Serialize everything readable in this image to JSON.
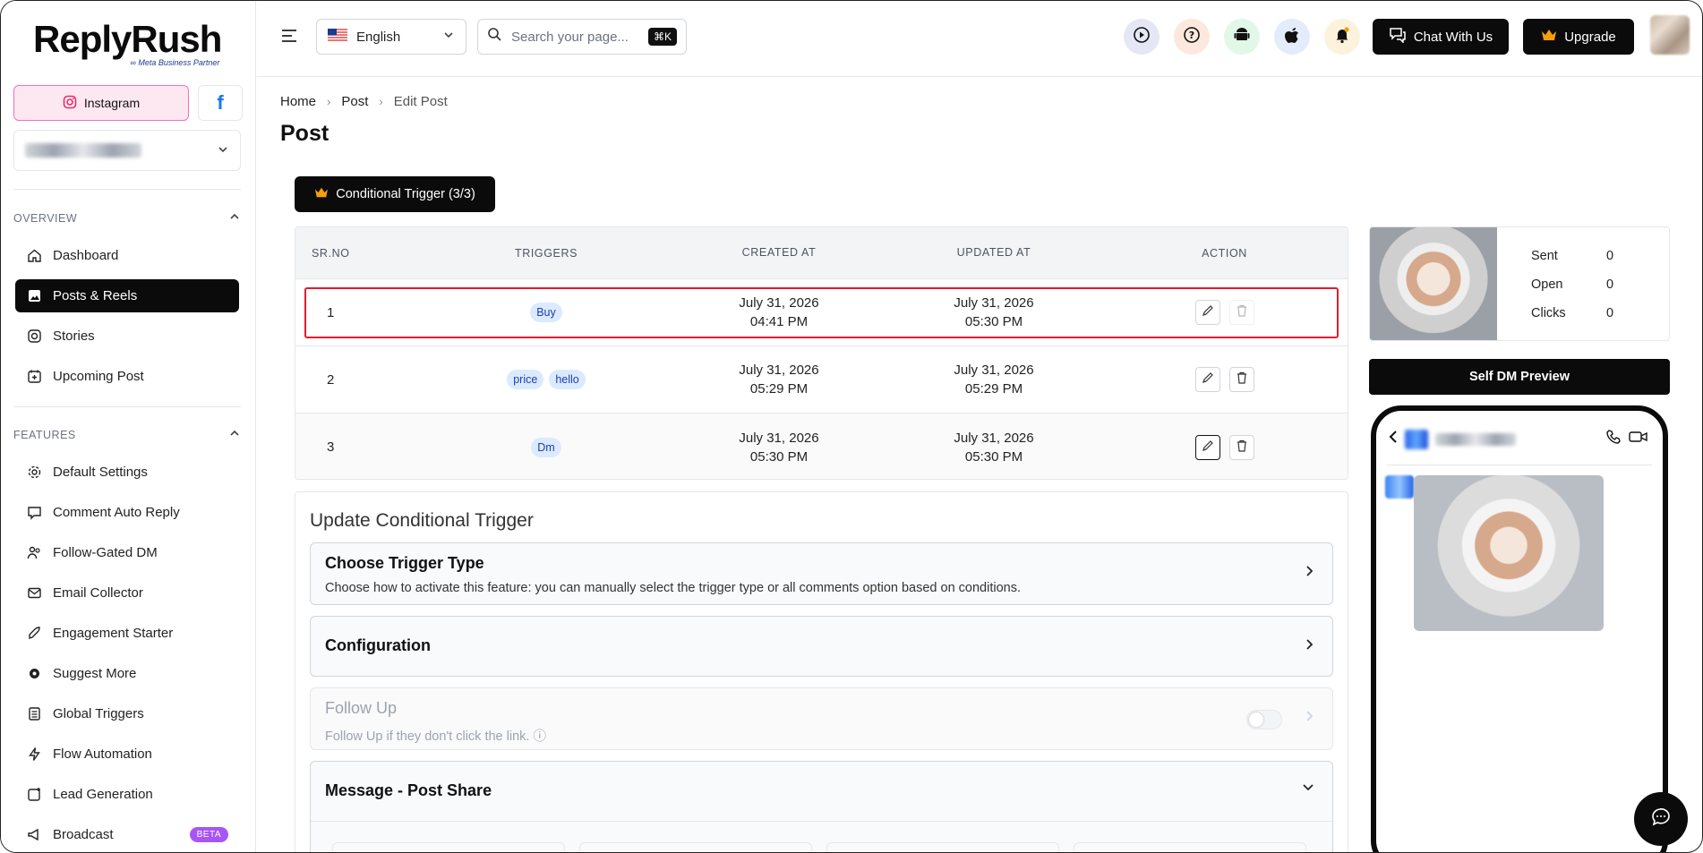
{
  "brand": {
    "name": "ReplyRush",
    "partner": "Meta Business Partner"
  },
  "platforms": {
    "instagram_label": "Instagram",
    "facebook_label": "f"
  },
  "sidebar": {
    "overview_label": "OVERVIEW",
    "overview_items": [
      {
        "label": "Dashboard",
        "icon": "home-icon"
      },
      {
        "label": "Posts & Reels",
        "icon": "image-icon",
        "active": true
      },
      {
        "label": "Stories",
        "icon": "instagram-icon"
      },
      {
        "label": "Upcoming Post",
        "icon": "calendar-plus-icon"
      }
    ],
    "features_label": "FEATURES",
    "feature_items": [
      {
        "label": "Default Settings",
        "icon": "gear-icon"
      },
      {
        "label": "Comment Auto Reply",
        "icon": "comment-icon"
      },
      {
        "label": "Follow-Gated DM",
        "icon": "users-icon"
      },
      {
        "label": "Email Collector",
        "icon": "mail-icon"
      },
      {
        "label": "Engagement Starter",
        "icon": "rocket-icon"
      },
      {
        "label": "Suggest More",
        "icon": "cog-icon"
      },
      {
        "label": "Global Triggers",
        "icon": "list-icon"
      },
      {
        "label": "Flow Automation",
        "icon": "bolt-icon"
      },
      {
        "label": "Lead Generation",
        "icon": "lead-icon"
      },
      {
        "label": "Broadcast",
        "icon": "megaphone-icon",
        "badge": "BETA"
      }
    ]
  },
  "header": {
    "language": "English",
    "search_placeholder": "Search your page...",
    "search_shortcut": "⌘K",
    "chat_label": "Chat With Us",
    "upgrade_label": "Upgrade",
    "accent": "#0b0b0b"
  },
  "breadcrumb": {
    "home": "Home",
    "post": "Post",
    "current": "Edit Post"
  },
  "page_title": "Post",
  "conditional_button": "Conditional Trigger (3/3)",
  "table": {
    "headers": {
      "srno": "SR.NO",
      "triggers": "TRIGGERS",
      "created": "CREATED AT",
      "updated": "UPDATED AT",
      "action": "ACTION"
    },
    "rows": [
      {
        "sr": "1",
        "tags": [
          "Buy"
        ],
        "created_date": "July 31, 2026",
        "created_time": "04:41 PM",
        "updated_date": "July 31, 2026",
        "updated_time": "05:30 PM"
      },
      {
        "sr": "2",
        "tags": [
          "price",
          "hello"
        ],
        "created_date": "July 31, 2026",
        "created_time": "05:29 PM",
        "updated_date": "July 31, 2026",
        "updated_time": "05:29 PM"
      },
      {
        "sr": "3",
        "tags": [
          "Dm"
        ],
        "created_date": "July 31, 2026",
        "created_time": "05:30 PM",
        "updated_date": "July 31, 2026",
        "updated_time": "05:30 PM"
      }
    ]
  },
  "update": {
    "title": "Update Conditional Trigger",
    "trigger_type_title": "Choose Trigger Type",
    "trigger_type_desc": "Choose how to activate this feature: you can manually select the trigger type or all comments option based on conditions.",
    "configuration_title": "Configuration",
    "followup_title": "Follow Up",
    "followup_desc": "Follow Up if they don't click the link.",
    "message_title": "Message - Post Share"
  },
  "stats": {
    "sent_label": "Sent",
    "sent": "0",
    "open_label": "Open",
    "open": "0",
    "clicks_label": "Clicks",
    "clicks": "0"
  },
  "self_dm_label": "Self DM Preview",
  "colors": {
    "highlight": "#e11d2e",
    "tag_bg": "#dbeafe",
    "tag_text": "#1e40af",
    "instagram_bg": "#fde7f1",
    "beta": "#a855f7"
  }
}
